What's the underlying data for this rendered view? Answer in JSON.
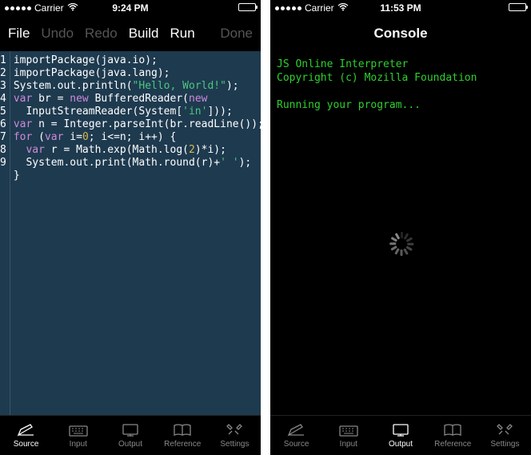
{
  "left": {
    "status": {
      "carrier": "Carrier",
      "time": "9:24 PM"
    },
    "toolbar": {
      "file": "File",
      "undo": "Undo",
      "redo": "Redo",
      "build": "Build",
      "run": "Run",
      "done": "Done"
    },
    "code_lines": [
      [
        [
          "",
          "importPackage(java.io);"
        ]
      ],
      [
        [
          "",
          "importPackage(java.lang);"
        ]
      ],
      [
        [
          "",
          "System.out.println("
        ],
        [
          "str",
          "\"Hello, World!\""
        ],
        [
          "",
          ");"
        ]
      ],
      [
        [
          "kw",
          "var"
        ],
        [
          "",
          " br = "
        ],
        [
          "kw",
          "new"
        ],
        [
          "",
          " BufferedReader("
        ],
        [
          "kw",
          "new"
        ]
      ],
      [
        [
          "",
          "  InputStreamReader(System["
        ],
        [
          "str",
          "'in'"
        ],
        [
          "",
          "]));"
        ]
      ],
      [
        [
          "kw",
          "var"
        ],
        [
          "",
          " n = Integer.parseInt(br.readLine());"
        ]
      ],
      [
        [
          "kw",
          "for"
        ],
        [
          "",
          " ("
        ],
        [
          "kw",
          "var"
        ],
        [
          "",
          " i="
        ],
        [
          "num",
          "0"
        ],
        [
          "",
          "; i<=n; i++) {"
        ]
      ],
      [
        [
          "",
          "  "
        ],
        [
          "kw",
          "var"
        ],
        [
          "",
          " r = Math.exp(Math.log("
        ],
        [
          "num",
          "2"
        ],
        [
          "",
          ")*i);"
        ]
      ],
      [
        [
          "",
          "  System.out.print(Math.round(r)+"
        ],
        [
          "str",
          "' '"
        ],
        [
          "",
          ");"
        ]
      ],
      [
        [
          "",
          "}"
        ]
      ]
    ],
    "line_count": 9,
    "tabs": [
      "Source",
      "Input",
      "Output",
      "Reference",
      "Settings"
    ],
    "active_tab": 0
  },
  "right": {
    "status": {
      "carrier": "Carrier",
      "time": "11:53 PM"
    },
    "title": "Console",
    "console_lines": [
      "JS Online Interpreter",
      "Copyright (c) Mozilla Foundation",
      "",
      "Running your program..."
    ],
    "tabs": [
      "Source",
      "Input",
      "Output",
      "Reference",
      "Settings"
    ],
    "active_tab": 2
  },
  "tab_icons": [
    "pen",
    "keyboard",
    "monitor",
    "book",
    "tools"
  ]
}
